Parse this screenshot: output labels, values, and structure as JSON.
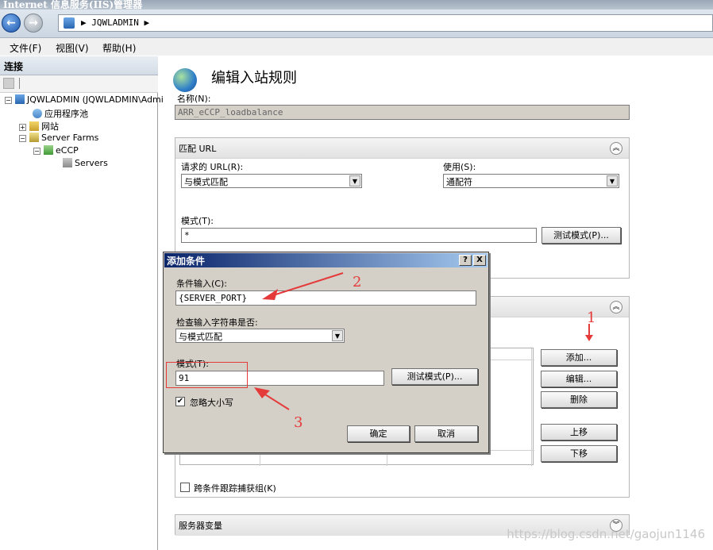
{
  "window": {
    "title": "Internet 信息服务(IIS)管理器"
  },
  "address": {
    "path": "▶ JQWLADMIN ▶"
  },
  "menu": {
    "items": [
      "文件(F)",
      "视图(V)",
      "帮助(H)"
    ]
  },
  "connections": {
    "header": "连接",
    "tree": [
      {
        "label": "JQWLADMIN (JQWLADMIN\\Admin",
        "expander": "−"
      },
      {
        "label": "应用程序池",
        "expander": ""
      },
      {
        "label": "网站",
        "expander": "+"
      },
      {
        "label": "Server Farms",
        "expander": "−"
      },
      {
        "label": "eCCP",
        "expander": "−"
      },
      {
        "label": "Servers",
        "expander": ""
      }
    ]
  },
  "main": {
    "title": "编辑入站规则",
    "name_label": "名称(N):",
    "name_value": "ARR_eCCP_loadbalance",
    "match": {
      "header": "匹配 URL",
      "requested_url_label": "请求的 URL(R):",
      "requested_url_value": "与模式匹配",
      "using_label": "使用(S):",
      "using_value": "通配符",
      "pattern_label": "模式(T):",
      "pattern_value": "*",
      "test_button": "测试模式(P)..."
    },
    "conditions": {
      "add_button": "添加...",
      "edit_button": "编辑...",
      "delete_button": "删除",
      "up_button": "上移",
      "down_button": "下移",
      "track_label": "跨条件跟踪捕获组(K)"
    },
    "server_vars": {
      "header": "服务器变量"
    }
  },
  "dialog": {
    "title": "添加条件",
    "help": "?",
    "close": "X",
    "input_label": "条件输入(C):",
    "input_value": "{SERVER_PORT}",
    "check_label": "检查输入字符串是否:",
    "check_value": "与模式匹配",
    "pattern_label": "模式(T):",
    "pattern_value": "91",
    "test_button": "测试模式(P)...",
    "ignore_case_label": "忽略大小写",
    "ok_button": "确定",
    "cancel_button": "取消"
  },
  "annotations": {
    "one": "1",
    "two": "2",
    "three": "3"
  },
  "watermark": "https://blog.csdn.net/gaojun1146"
}
